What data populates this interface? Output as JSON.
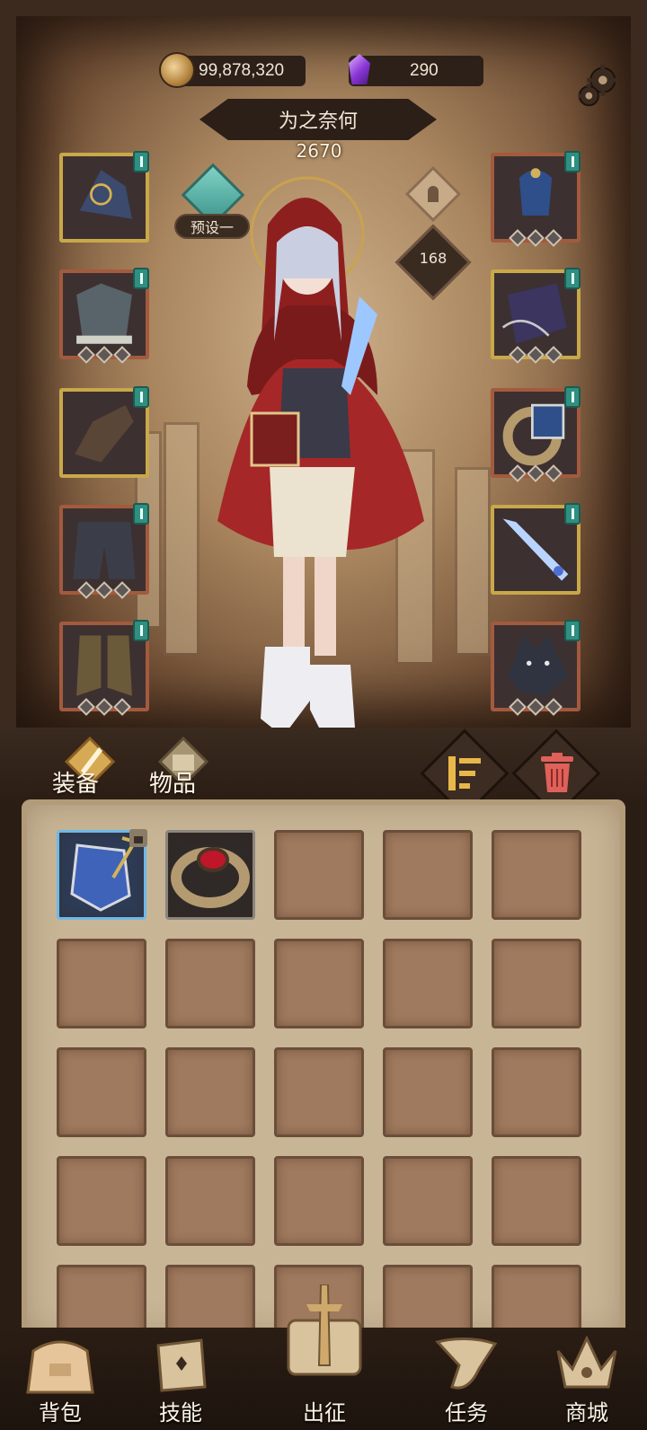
{
  "currency": {
    "coins": "99,878,320",
    "gems": "290"
  },
  "hero": {
    "name": "为之奈何",
    "power": "2670",
    "level": "168",
    "preset": "预设一"
  },
  "tabs": {
    "equip": "装备",
    "items": "物品"
  },
  "bottom_nav": {
    "bag": "背包",
    "skill": "技能",
    "expedition": "出征",
    "quest": "任务",
    "shop": "商城"
  },
  "icons": {
    "coin": "coin-icon",
    "gem": "gem-icon",
    "settings": "gear-icon",
    "preset": "preset-emblem-icon",
    "gender": "gender-icon",
    "sort": "sort-icon",
    "trash": "trash-icon"
  },
  "colors": {
    "frame_dark": "#2a1d14",
    "panel": "#c8b596",
    "slot": "#a07a5e",
    "accent_teal": "#2f8f80",
    "trash_red": "#e0605a",
    "sort_gold": "#e8b84a"
  }
}
